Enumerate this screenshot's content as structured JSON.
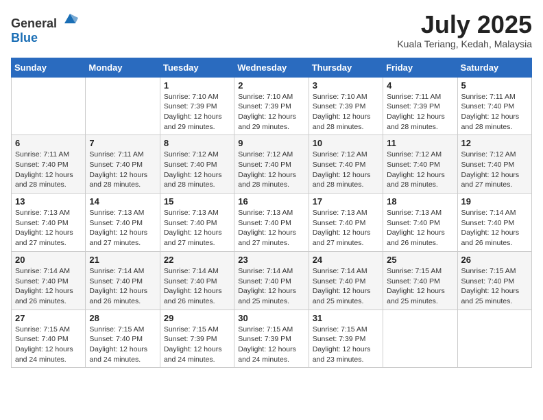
{
  "logo": {
    "general": "General",
    "blue": "Blue"
  },
  "title": {
    "month_year": "July 2025",
    "location": "Kuala Teriang, Kedah, Malaysia"
  },
  "weekdays": [
    "Sunday",
    "Monday",
    "Tuesday",
    "Wednesday",
    "Thursday",
    "Friday",
    "Saturday"
  ],
  "weeks": [
    [
      {
        "day": "",
        "info": ""
      },
      {
        "day": "",
        "info": ""
      },
      {
        "day": "1",
        "info": "Sunrise: 7:10 AM\nSunset: 7:39 PM\nDaylight: 12 hours and 29 minutes."
      },
      {
        "day": "2",
        "info": "Sunrise: 7:10 AM\nSunset: 7:39 PM\nDaylight: 12 hours and 29 minutes."
      },
      {
        "day": "3",
        "info": "Sunrise: 7:10 AM\nSunset: 7:39 PM\nDaylight: 12 hours and 28 minutes."
      },
      {
        "day": "4",
        "info": "Sunrise: 7:11 AM\nSunset: 7:39 PM\nDaylight: 12 hours and 28 minutes."
      },
      {
        "day": "5",
        "info": "Sunrise: 7:11 AM\nSunset: 7:40 PM\nDaylight: 12 hours and 28 minutes."
      }
    ],
    [
      {
        "day": "6",
        "info": "Sunrise: 7:11 AM\nSunset: 7:40 PM\nDaylight: 12 hours and 28 minutes."
      },
      {
        "day": "7",
        "info": "Sunrise: 7:11 AM\nSunset: 7:40 PM\nDaylight: 12 hours and 28 minutes."
      },
      {
        "day": "8",
        "info": "Sunrise: 7:12 AM\nSunset: 7:40 PM\nDaylight: 12 hours and 28 minutes."
      },
      {
        "day": "9",
        "info": "Sunrise: 7:12 AM\nSunset: 7:40 PM\nDaylight: 12 hours and 28 minutes."
      },
      {
        "day": "10",
        "info": "Sunrise: 7:12 AM\nSunset: 7:40 PM\nDaylight: 12 hours and 28 minutes."
      },
      {
        "day": "11",
        "info": "Sunrise: 7:12 AM\nSunset: 7:40 PM\nDaylight: 12 hours and 28 minutes."
      },
      {
        "day": "12",
        "info": "Sunrise: 7:12 AM\nSunset: 7:40 PM\nDaylight: 12 hours and 27 minutes."
      }
    ],
    [
      {
        "day": "13",
        "info": "Sunrise: 7:13 AM\nSunset: 7:40 PM\nDaylight: 12 hours and 27 minutes."
      },
      {
        "day": "14",
        "info": "Sunrise: 7:13 AM\nSunset: 7:40 PM\nDaylight: 12 hours and 27 minutes."
      },
      {
        "day": "15",
        "info": "Sunrise: 7:13 AM\nSunset: 7:40 PM\nDaylight: 12 hours and 27 minutes."
      },
      {
        "day": "16",
        "info": "Sunrise: 7:13 AM\nSunset: 7:40 PM\nDaylight: 12 hours and 27 minutes."
      },
      {
        "day": "17",
        "info": "Sunrise: 7:13 AM\nSunset: 7:40 PM\nDaylight: 12 hours and 27 minutes."
      },
      {
        "day": "18",
        "info": "Sunrise: 7:13 AM\nSunset: 7:40 PM\nDaylight: 12 hours and 26 minutes."
      },
      {
        "day": "19",
        "info": "Sunrise: 7:14 AM\nSunset: 7:40 PM\nDaylight: 12 hours and 26 minutes."
      }
    ],
    [
      {
        "day": "20",
        "info": "Sunrise: 7:14 AM\nSunset: 7:40 PM\nDaylight: 12 hours and 26 minutes."
      },
      {
        "day": "21",
        "info": "Sunrise: 7:14 AM\nSunset: 7:40 PM\nDaylight: 12 hours and 26 minutes."
      },
      {
        "day": "22",
        "info": "Sunrise: 7:14 AM\nSunset: 7:40 PM\nDaylight: 12 hours and 26 minutes."
      },
      {
        "day": "23",
        "info": "Sunrise: 7:14 AM\nSunset: 7:40 PM\nDaylight: 12 hours and 25 minutes."
      },
      {
        "day": "24",
        "info": "Sunrise: 7:14 AM\nSunset: 7:40 PM\nDaylight: 12 hours and 25 minutes."
      },
      {
        "day": "25",
        "info": "Sunrise: 7:15 AM\nSunset: 7:40 PM\nDaylight: 12 hours and 25 minutes."
      },
      {
        "day": "26",
        "info": "Sunrise: 7:15 AM\nSunset: 7:40 PM\nDaylight: 12 hours and 25 minutes."
      }
    ],
    [
      {
        "day": "27",
        "info": "Sunrise: 7:15 AM\nSunset: 7:40 PM\nDaylight: 12 hours and 24 minutes."
      },
      {
        "day": "28",
        "info": "Sunrise: 7:15 AM\nSunset: 7:40 PM\nDaylight: 12 hours and 24 minutes."
      },
      {
        "day": "29",
        "info": "Sunrise: 7:15 AM\nSunset: 7:39 PM\nDaylight: 12 hours and 24 minutes."
      },
      {
        "day": "30",
        "info": "Sunrise: 7:15 AM\nSunset: 7:39 PM\nDaylight: 12 hours and 24 minutes."
      },
      {
        "day": "31",
        "info": "Sunrise: 7:15 AM\nSunset: 7:39 PM\nDaylight: 12 hours and 23 minutes."
      },
      {
        "day": "",
        "info": ""
      },
      {
        "day": "",
        "info": ""
      }
    ]
  ]
}
